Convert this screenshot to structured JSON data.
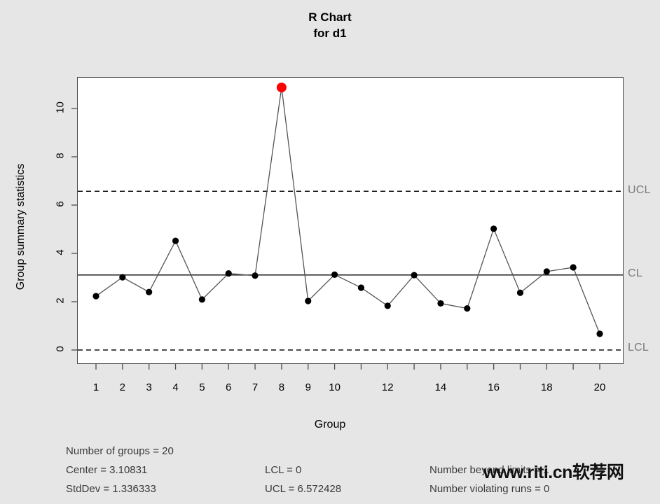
{
  "title": {
    "line1": "R Chart",
    "line2": "for d1"
  },
  "axes": {
    "ylabel": "Group summary statistics",
    "xlabel": "Group",
    "yticks": [
      0,
      2,
      4,
      6,
      8,
      10
    ],
    "xticks": [
      "1",
      "2",
      "3",
      "4",
      "5",
      "6",
      "7",
      "8",
      "9",
      "10",
      "",
      "12",
      "",
      "14",
      "",
      "16",
      "",
      "18",
      "",
      "20"
    ]
  },
  "limits": {
    "ucl_label": "UCL",
    "cl_label": "CL",
    "lcl_label": "LCL"
  },
  "stats": {
    "groups": "Number of groups = 20",
    "center": "Center = 3.10831",
    "stddev": "StdDev = 1.336333",
    "lcl": "LCL = 0",
    "ucl": "UCL = 6.572428",
    "beyond": "Number beyond limits = 1",
    "runs": "Number violating runs = 0"
  },
  "watermark": {
    "text": "www.riti.cn软荐网"
  },
  "colors": {
    "violation_point": "#ff0000",
    "point": "#000000",
    "line": "#555555",
    "limit_label": "#7a7a7a",
    "panel": "#ffffff",
    "background": "#e6e6e6"
  },
  "chart_data": {
    "type": "line",
    "title": "R Chart for d1",
    "xlabel": "Group",
    "ylabel": "Group summary statistics",
    "xlim": [
      0.5,
      20.5
    ],
    "ylim": [
      -0.45,
      11.5
    ],
    "grid": false,
    "legend": "none",
    "x": [
      1,
      2,
      3,
      4,
      5,
      6,
      7,
      8,
      9,
      10,
      11,
      12,
      13,
      14,
      15,
      16,
      17,
      18,
      19,
      20
    ],
    "values": [
      2.23,
      3.01,
      2.4,
      4.52,
      2.09,
      3.17,
      3.08,
      10.87,
      2.03,
      3.12,
      2.58,
      1.83,
      3.1,
      1.93,
      1.72,
      5.02,
      2.37,
      3.25,
      3.42,
      0.67
    ],
    "violations": [
      8
    ],
    "center_line": 3.10831,
    "upper_control_limit": 6.572428,
    "lower_control_limit": 0,
    "annotations": [
      "UCL",
      "CL",
      "LCL"
    ],
    "number_of_groups": 20,
    "stddev": 1.336333,
    "number_beyond_limits": 1,
    "number_violating_runs": 0
  }
}
